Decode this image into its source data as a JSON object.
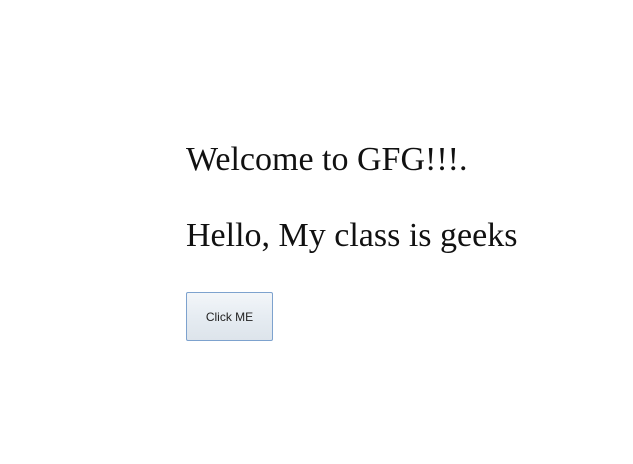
{
  "main": {
    "welcome_text": "Welcome to GFG!!!.",
    "class_text": "Hello, My class is geeks",
    "button_label": "Click ME"
  }
}
